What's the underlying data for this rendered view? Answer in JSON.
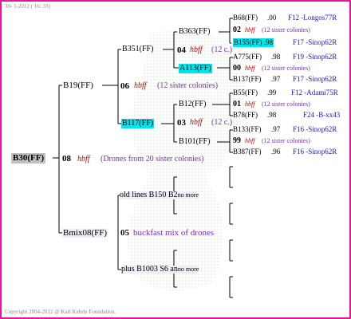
{
  "header": {
    "date": "30-  1-2012 ( 16: 33)"
  },
  "footer": {
    "copyright": "Copyright 2004-2012 @ Karl Kehrle Foundation."
  },
  "colors": {
    "border": "#e8149b",
    "hbff": "#c00000",
    "sister": "#7b2bb0",
    "pedigree": "#1818c0",
    "highlight": "#00e5ee"
  },
  "root": {
    "label": "B30(FF)",
    "num": "08",
    "hbff": "hbff",
    "note": "(Drones from 20 sister colonies)"
  },
  "gen1": {
    "top": {
      "label": "B19(FF)"
    },
    "bottom": {
      "label": "Bmix08(FF)",
      "num": "05",
      "note": "buckfast mix of drones"
    }
  },
  "gen2": {
    "b351": {
      "label": "B351(FF)"
    },
    "b351_mid": {
      "num": "06",
      "hbff": "hbff",
      "note": "(12 sister colonies)"
    },
    "b117": {
      "label": "B117(FF)"
    },
    "oldlines": {
      "label": "old lines B150 B2",
      "suffix": "no more"
    },
    "plus": {
      "label": "plus B1003 S6 an",
      "suffix": "no more"
    }
  },
  "gen3": {
    "b363": {
      "label": "B363(FF)"
    },
    "b363_mid": {
      "num": "04",
      "hbff": "hbff",
      "note": "(12 c.)"
    },
    "a113": {
      "label": "A113(FF)"
    },
    "b12": {
      "label": "B12(FF)"
    },
    "b12_mid": {
      "num": "03",
      "hbff": "hbff",
      "note": "(12 c.)"
    },
    "b101": {
      "label": "B101(FF)"
    }
  },
  "gen4": [
    {
      "label": "B68(FF)",
      "score": ".00",
      "ped": "F12 -Longos77R"
    },
    {
      "num": "02",
      "hbff": "hbff",
      "note": "(12 sister colonies)"
    },
    {
      "label": "B155(FF)",
      "score": ".98",
      "ped": "F17 -Sinop62R"
    },
    {
      "label": "A775(FF)",
      "score": ".98",
      "ped": "F19 -Sinop62R"
    },
    {
      "num": "00",
      "hbff": "hbff",
      "note": "(12 sister colonies)"
    },
    {
      "label": "B137(FF)",
      "score": ".97",
      "ped": "F17 -Sinop62R"
    },
    {
      "label": "B55(FF)",
      "score": ".99",
      "ped": "F12 -Adami75R"
    },
    {
      "num": "01",
      "hbff": "hbff",
      "note": "(12 sister colonies)"
    },
    {
      "label": "B78(FF)",
      "score": ".98",
      "ped": "F24 -B-xx43"
    },
    {
      "label": "B133(FF)",
      "score": ".97",
      "ped": "F16 -Sinop62R"
    },
    {
      "num": "99",
      "hbff": "hbff",
      "note": "(12 sister colonies)"
    },
    {
      "label": "B387(FF)",
      "score": ".96",
      "ped": "F16 -Sinop62R"
    }
  ]
}
